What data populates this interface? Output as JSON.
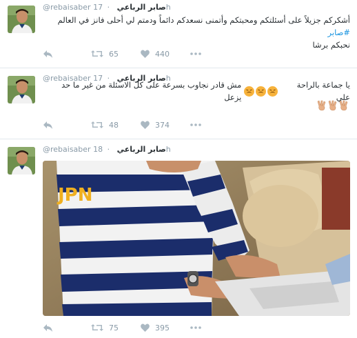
{
  "colors": {
    "link": "#1b95e0",
    "icon": "#aab8c2",
    "meta": "#8899a6",
    "text": "#292f33"
  },
  "icons": {
    "reply": "reply-icon",
    "retweet": "retweet-icon",
    "like": "heart-icon",
    "more": "more-icon"
  },
  "tweets": [
    {
      "handle": "@rebaisaber",
      "name": "صابر الرباعي",
      "dot": "·",
      "time": "17h",
      "line1": "أشكركم جزيلاً على أسئلتكم ومحبتكم وأتمنى نسعدكم دائماً ودمتم لي أحلى فانز في العالم",
      "hashtag": "#صابر",
      "line2": "نحبكم برشا",
      "retweets": "65",
      "likes": "440"
    },
    {
      "handle": "@rebaisaber",
      "name": "صابر الرباعي",
      "dot": "·",
      "time": "17h",
      "line1_a": "مش قادر نجاوب بسرعة على كل الاسئلة من غير ما حد يزعل",
      "line1_b": "يا جماعة بالراحة علي",
      "retweets": "48",
      "likes": "374"
    },
    {
      "handle": "@rebaisaber",
      "name": "صابر الرباعي",
      "dot": "·",
      "time": "18h",
      "shirt_text": "JPN",
      "retweets": "75",
      "likes": "395"
    }
  ]
}
